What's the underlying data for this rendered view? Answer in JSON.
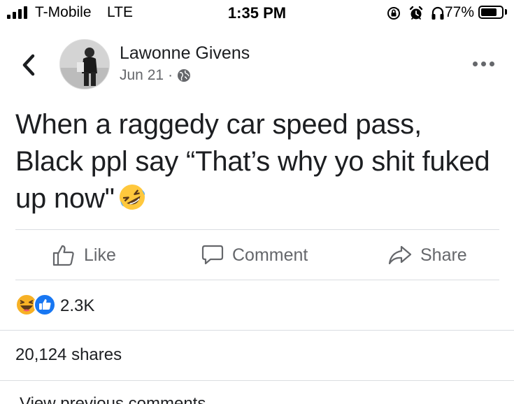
{
  "status_bar": {
    "carrier": "T-Mobile",
    "network": "LTE",
    "time": "1:35 PM",
    "battery_percent": "77%",
    "battery_level": 0.77,
    "icons": [
      "signal-bars-icon",
      "lock-rotation-icon",
      "alarm-icon",
      "headphones-icon",
      "battery-icon"
    ]
  },
  "post": {
    "author": "Lawonne Givens",
    "date": "Jun 21",
    "separator": "·",
    "privacy_icon": "globe-icon",
    "text_line1": "When a raggedy car speed pass,",
    "text_line2": "Black ppl say “That’s why yo shit fuked",
    "text_line3": "up now\"",
    "text_emoji": "rolling-on-floor-laughing-emoji"
  },
  "actions": {
    "like_label": "Like",
    "comment_label": "Comment",
    "share_label": "Share"
  },
  "reactions": {
    "types": [
      "haha-reaction-icon",
      "like-reaction-icon"
    ],
    "count": "2.3K"
  },
  "shares_text": "20,124 shares",
  "view_comments": "View previous comments",
  "colors": {
    "text": "#1c1e21",
    "muted": "#65676b",
    "like_blue": "#1877f2",
    "haha_yellow": "#f7b125",
    "divider": "#dadde1"
  }
}
